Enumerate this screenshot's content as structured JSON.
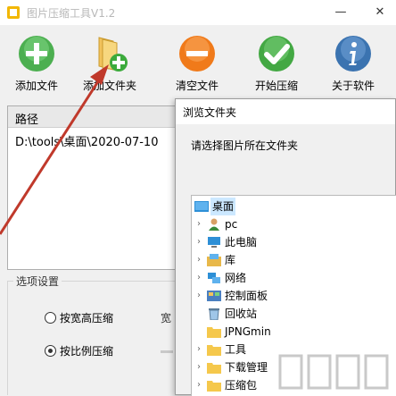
{
  "window": {
    "title": "图片压缩工具V1.2",
    "minimize": "—",
    "close": "✕"
  },
  "toolbar": {
    "items": [
      {
        "label": "添加文件",
        "icon": "add-file-icon",
        "color": "#4caf50"
      },
      {
        "label": "添加文件夹",
        "icon": "add-folder-icon",
        "color": "#f2c35c"
      },
      {
        "label": "清空文件",
        "icon": "clear-files-icon",
        "color": "#f07a1a"
      },
      {
        "label": "开始压缩",
        "icon": "start-compress-icon",
        "color": "#43a843"
      },
      {
        "label": "关于软件",
        "icon": "info-icon",
        "color": "#3b73b0"
      }
    ]
  },
  "file_list": {
    "header": "路径",
    "rows": [
      "D:\\tools\\桌面\\2020-07-10"
    ]
  },
  "options": {
    "legend": "选项设置",
    "radio_width_height": "按宽高压缩",
    "radio_ratio": "按比例压缩",
    "partial_width_label": "宽",
    "selected": "radio_ratio"
  },
  "dialog": {
    "title": "浏览文件夹",
    "prompt": "请选择图片所在文件夹",
    "tree": [
      {
        "label": "桌面",
        "icon": "desktop-icon",
        "expandable": false,
        "selected": true
      },
      {
        "label": "pc",
        "icon": "user-icon",
        "expandable": true,
        "selected": false
      },
      {
        "label": "此电脑",
        "icon": "computer-icon",
        "expandable": true,
        "selected": false
      },
      {
        "label": "库",
        "icon": "library-icon",
        "expandable": true,
        "selected": false
      },
      {
        "label": "网络",
        "icon": "network-icon",
        "expandable": true,
        "selected": false
      },
      {
        "label": "控制面板",
        "icon": "control-panel-icon",
        "expandable": true,
        "selected": false
      },
      {
        "label": "回收站",
        "icon": "recycle-bin-icon",
        "expandable": false,
        "selected": false
      },
      {
        "label": "JPNGmin",
        "icon": "folder-icon",
        "expandable": false,
        "selected": false
      },
      {
        "label": "工具",
        "icon": "folder-icon",
        "expandable": true,
        "selected": false
      },
      {
        "label": "下载管理",
        "icon": "folder-icon",
        "expandable": true,
        "selected": false
      },
      {
        "label": "压缩包",
        "icon": "folder-icon",
        "expandable": true,
        "selected": false
      }
    ]
  },
  "colors": {
    "arrow": "#c0392b",
    "selection": "#cce8ff"
  }
}
